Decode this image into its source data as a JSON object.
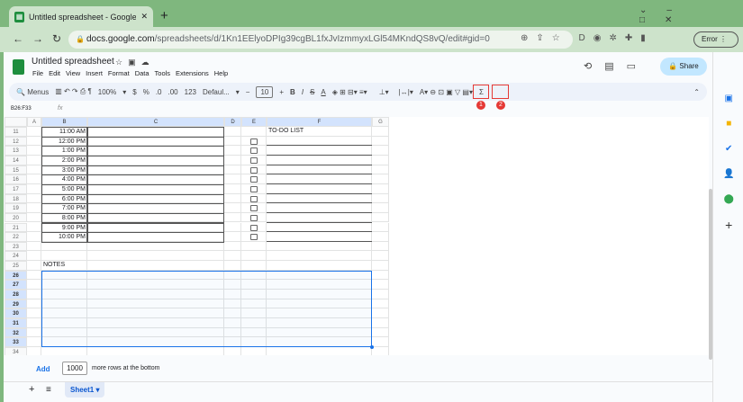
{
  "browser": {
    "tab_title": "Untitled spreadsheet - Google S",
    "url_domain": "docs.google.com",
    "url_path": "/spreadsheets/d/1Kn1EElyoDPIg39cgBL1fxJvIzmmyxLGl54MKndQS8vQ/edit#gid=0",
    "profile_button": "Error",
    "new_tab": "+",
    "close": "✕"
  },
  "app": {
    "title": "Untitled spreadsheet",
    "menus": [
      "File",
      "Edit",
      "View",
      "Insert",
      "Format",
      "Data",
      "Tools",
      "Extensions",
      "Help"
    ],
    "share": "Share"
  },
  "toolbar": {
    "search": "Menus",
    "zoom": "100%",
    "currency": "$",
    "percent": "%",
    "dec_less": ".0",
    "dec_more": ".00",
    "format_123": "123",
    "font": "Defaul...",
    "font_size": "10",
    "minus": "−",
    "plus": "+",
    "bold": "B",
    "italic": "I",
    "strike": "S",
    "text_color": "A",
    "sigma": "Σ",
    "callout1": "1",
    "callout2": "2"
  },
  "formula_bar": {
    "name_box": "B26:F33",
    "fx": "fx"
  },
  "columns": [
    "A",
    "B",
    "C",
    "D",
    "E",
    "F",
    "G"
  ],
  "rows": [
    "11",
    "12",
    "13",
    "14",
    "15",
    "16",
    "17",
    "18",
    "19",
    "20",
    "21",
    "22",
    "23",
    "24",
    "25",
    "26",
    "27",
    "28",
    "29",
    "30",
    "31",
    "32",
    "33",
    "34"
  ],
  "times": [
    "11:00 AM",
    "12:00 PM",
    "1:00 PM",
    "2:00 PM",
    "3:00 PM",
    "4:00 PM",
    "5:00 PM",
    "6:00 PM",
    "7:00 PM",
    "8:00 PM",
    "9:00 PM",
    "10:00 PM"
  ],
  "todo_label": "TO-DO LIST",
  "notes_label": "NOTES",
  "footer": {
    "add": "Add",
    "rows_value": "1000",
    "rows_text": "more rows at the bottom",
    "sheet": "Sheet1"
  }
}
